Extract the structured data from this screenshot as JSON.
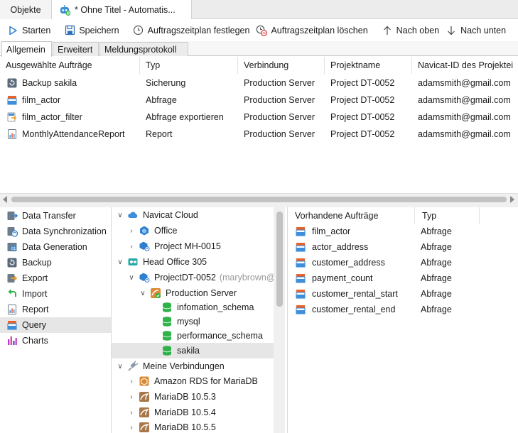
{
  "doc_tabs": {
    "objects": "Objekte",
    "untitled": "* Ohne Titel - Automatis..."
  },
  "toolbar": {
    "start": "Starten",
    "save": "Speichern",
    "set_schedule": "Auftragszeitplan festlegen",
    "delete_schedule": "Auftragszeitplan löschen",
    "move_up": "Nach oben",
    "move_down": "Nach unten"
  },
  "subtabs": [
    "Allgemein",
    "Erweitert",
    "Meldungsprotokoll"
  ],
  "jobs": {
    "columns": [
      "Ausgewählte Aufträge",
      "Typ",
      "Verbindung",
      "Projektname",
      "Navicat-ID des Projektei"
    ],
    "rows": [
      {
        "name": "Backup sakila",
        "type": "Sicherung",
        "conn": "Production Server",
        "project": "Project DT-0052",
        "owner": "adamsmith@gmail.com",
        "icon": "backup-icon"
      },
      {
        "name": "film_actor",
        "type": "Abfrage",
        "conn": "Production Server",
        "project": "Project DT-0052",
        "owner": "adamsmith@gmail.com",
        "icon": "query-icon"
      },
      {
        "name": "film_actor_filter",
        "type": "Abfrage exportieren",
        "conn": "Production Server",
        "project": "Project DT-0052",
        "owner": "adamsmith@gmail.com",
        "icon": "query-export-icon"
      },
      {
        "name": "MonthlyAttendanceReport",
        "type": "Report",
        "conn": "Production Server",
        "project": "Project DT-0052",
        "owner": "adamsmith@gmail.com",
        "icon": "report-icon"
      }
    ]
  },
  "categories": [
    {
      "label": "Data Transfer",
      "icon": "data-transfer-icon"
    },
    {
      "label": "Data Synchronization",
      "icon": "data-sync-icon"
    },
    {
      "label": "Data Generation",
      "icon": "data-generation-icon"
    },
    {
      "label": "Backup",
      "icon": "backup-icon"
    },
    {
      "label": "Export",
      "icon": "export-icon"
    },
    {
      "label": "Import",
      "icon": "import-icon"
    },
    {
      "label": "Report",
      "icon": "report-icon"
    },
    {
      "label": "Query",
      "icon": "query-icon",
      "selected": true
    },
    {
      "label": "Charts",
      "icon": "charts-icon"
    }
  ],
  "tree": {
    "navicat_cloud": "Navicat Cloud",
    "office": "Office",
    "project_mh": "Project MH-0015",
    "head_office": "Head Office 305",
    "project_dt": "ProjectDT-0052",
    "project_dt_owner": "(marybrown@",
    "production_server": "Production Server",
    "db_info": "infomation_schema",
    "db_mysql": "mysql",
    "db_perf": "performance_schema",
    "db_sakila": "sakila",
    "my_connections": "Meine Verbindungen",
    "amazon_rds": "Amazon RDS for MariaDB",
    "mariadb_1": "MariaDB 10.5.3",
    "mariadb_2": "MariaDB 10.5.4",
    "mariadb_3": "MariaDB 10.5.5"
  },
  "available": {
    "columns": [
      "Vorhandene Aufträge",
      "Typ"
    ],
    "rows": [
      {
        "name": "film_actor",
        "type": "Abfrage"
      },
      {
        "name": "actor_address",
        "type": "Abfrage"
      },
      {
        "name": "customer_address",
        "type": "Abfrage"
      },
      {
        "name": "payment_count",
        "type": "Abfrage"
      },
      {
        "name": "customer_rental_start",
        "type": "Abfrage"
      },
      {
        "name": "customer_rental_end",
        "type": "Abfrage"
      }
    ]
  },
  "colors": {
    "accent_blue": "#2f7fd0",
    "selection_gray": "#e6e6e6",
    "db_green": "#2fb24a",
    "query_orange": "#e8632c"
  }
}
